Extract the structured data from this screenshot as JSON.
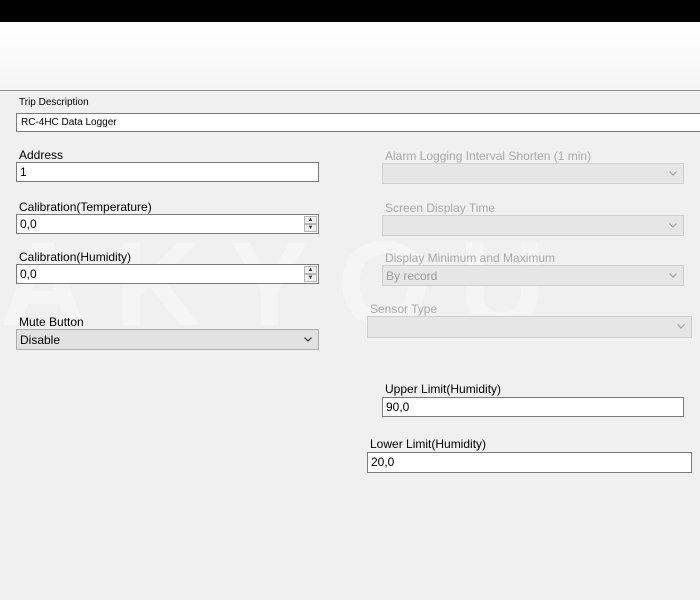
{
  "form": {
    "trip_description": {
      "label": "Trip Description",
      "value": "RC-4HC Data Logger"
    },
    "address": {
      "label": "Address",
      "value": "1"
    },
    "calibration_temperature": {
      "label": "Calibration(Temperature)",
      "value": "0,0"
    },
    "calibration_humidity": {
      "label": "Calibration(Humidity)",
      "value": "0,0"
    },
    "mute_button": {
      "label": "Mute Button",
      "value": "Disable"
    },
    "alarm_logging_interval": {
      "label": "Alarm Logging Interval Shorten (1 min)",
      "value": ""
    },
    "screen_display_time": {
      "label": "Screen Display Time",
      "value": ""
    },
    "display_min_max": {
      "label": "Display Minimum and Maximum",
      "value": "By record"
    },
    "sensor_type": {
      "label": "Sensor Type",
      "value": ""
    },
    "upper_limit_humidity": {
      "label": "Upper Limit(Humidity)",
      "value": "90,0"
    },
    "lower_limit_humidity": {
      "label": "Lower Limit(Humidity)",
      "value": "20,0"
    }
  },
  "icons": {
    "dropdown": "chevron-down-icon",
    "spin_up": "spin-up-icon",
    "spin_down": "spin-down-icon"
  },
  "colors": {
    "disabled_text": "#a8a8a8",
    "border": "#7a7a7a",
    "background": "#f0f0f0"
  }
}
